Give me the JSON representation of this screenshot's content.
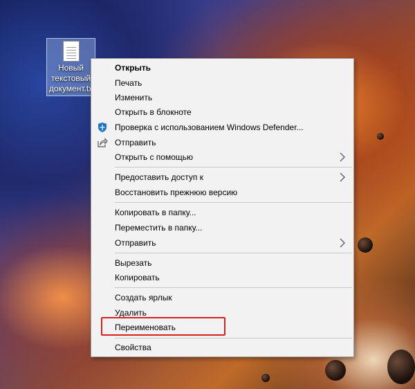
{
  "desktop": {
    "file_label": "Новый\nтекстовый\nдокумент.txt"
  },
  "menu": {
    "items": [
      {
        "label": "Открыть",
        "bold": true
      },
      {
        "label": "Печать"
      },
      {
        "label": "Изменить"
      },
      {
        "label": "Открыть в блокноте"
      },
      {
        "label": "Проверка с использованием Windows Defender...",
        "icon": "windows-defender-shield-icon"
      },
      {
        "label": "Отправить",
        "icon": "share-icon"
      },
      {
        "label": "Открыть с помощью",
        "submenu": true
      },
      {
        "label": "Предоставить доступ к",
        "submenu": true
      },
      {
        "label": "Восстановить прежнюю версию"
      },
      {
        "label": "Копировать в папку..."
      },
      {
        "label": "Переместить в папку..."
      },
      {
        "label": "Отправить",
        "submenu": true
      },
      {
        "label": "Вырезать"
      },
      {
        "label": "Копировать"
      },
      {
        "label": "Создать ярлык"
      },
      {
        "label": "Удалить"
      },
      {
        "label": "Переименовать",
        "highlighted": true
      },
      {
        "label": "Свойства"
      }
    ]
  },
  "colors": {
    "highlight_border": "#d62020",
    "menu_bg": "#f2f2f2",
    "defender_icon": "#1a73c8"
  }
}
